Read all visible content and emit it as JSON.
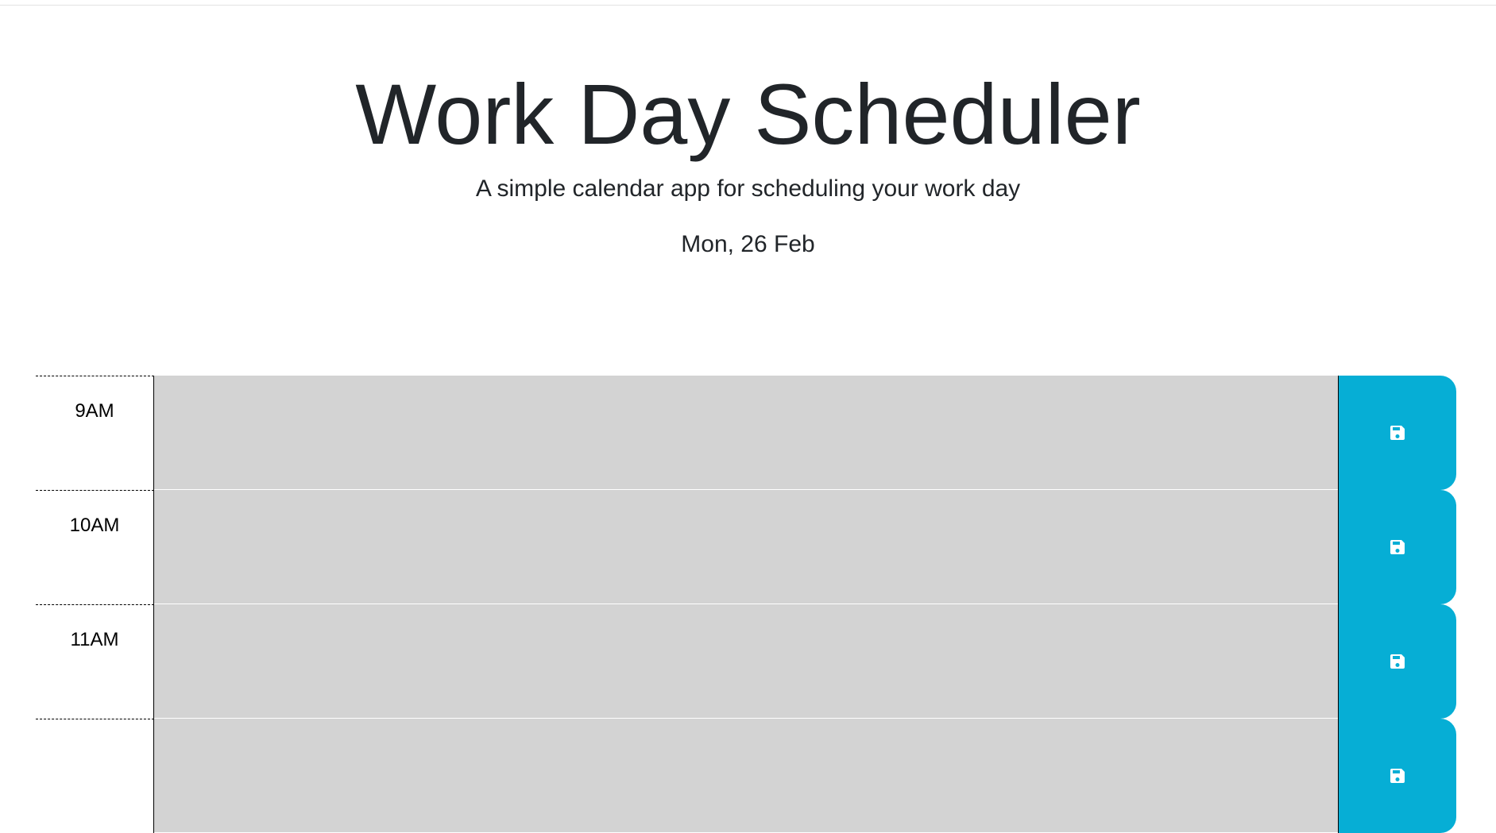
{
  "header": {
    "title": "Work Day Scheduler",
    "subtitle": "A simple calendar app for scheduling your work day",
    "current_day": "Mon, 26 Feb"
  },
  "timeblocks": [
    {
      "hour": "9AM",
      "description": "",
      "save_icon": "save-icon"
    },
    {
      "hour": "10AM",
      "description": "",
      "save_icon": "save-icon"
    },
    {
      "hour": "11AM",
      "description": "",
      "save_icon": "save-icon"
    },
    {
      "hour": "",
      "description": "",
      "save_icon": "save-icon"
    }
  ],
  "colors": {
    "past": "#d3d3d3",
    "save_button": "#06aed5",
    "text": "#212529"
  }
}
